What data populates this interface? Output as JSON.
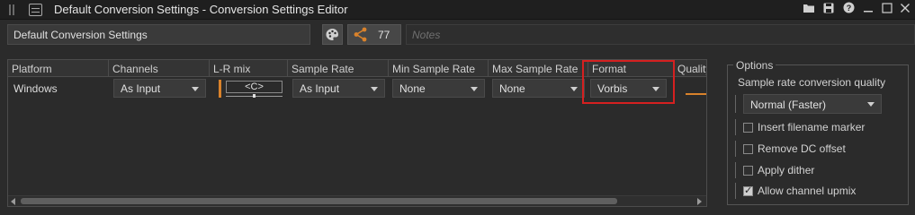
{
  "window": {
    "title": "Default Conversion Settings - Conversion Settings Editor",
    "buttons": [
      "folder-icon",
      "save-icon",
      "help-icon",
      "minimize-icon",
      "maximize-icon",
      "close-icon"
    ]
  },
  "toolbar": {
    "name_value": "Default Conversion Settings",
    "references_count": "77",
    "notes_placeholder": "Notes"
  },
  "table": {
    "columns": [
      "Platform",
      "Channels",
      "L-R mix",
      "Sample Rate",
      "Min Sample Rate",
      "Max Sample Rate",
      "Format",
      "Quality"
    ],
    "rows": [
      {
        "platform": "Windows",
        "channels": "As Input",
        "lr_mix": "<C>",
        "sample_rate": "As Input",
        "min_sample_rate": "None",
        "max_sample_rate": "None",
        "format": "Vorbis"
      }
    ]
  },
  "options": {
    "legend": "Options",
    "quality_label": "Sample rate conversion quality",
    "quality_value": "Normal (Faster)",
    "checkboxes": [
      {
        "label": "Insert filename marker",
        "checked": false
      },
      {
        "label": "Remove DC offset",
        "checked": false
      },
      {
        "label": "Apply dither",
        "checked": false
      },
      {
        "label": "Allow channel upmix",
        "checked": true
      }
    ]
  },
  "colors": {
    "accent": "#d9822b",
    "highlight": "#d52020",
    "background": "#2b2b2b"
  }
}
